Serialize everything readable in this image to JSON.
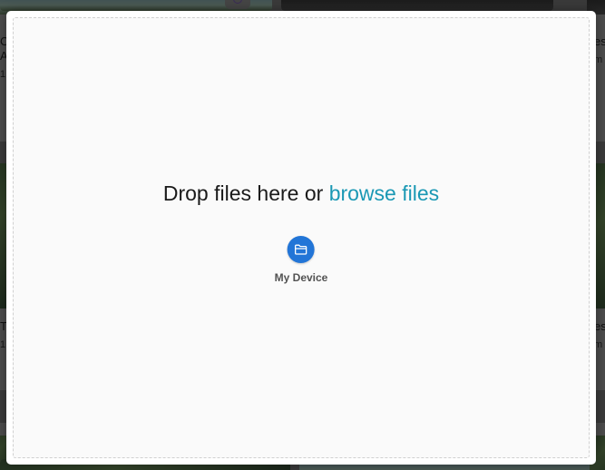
{
  "background": {
    "cards": [
      {
        "title_fragment": "C",
        "sub_fragment": "A",
        "meta_fragment": "1"
      },
      {
        "title_fragment": "es",
        "sub_fragment": "m"
      },
      {
        "title_fragment": "T",
        "meta_fragment": "1"
      },
      {
        "title_fragment": "es",
        "sub_fragment": "m"
      }
    ]
  },
  "uploader": {
    "drop_text": "Drop files here or",
    "browse_label": "browse files",
    "sources": [
      {
        "label": "My Device",
        "icon": "folder-icon"
      }
    ]
  },
  "colors": {
    "browse_link": "#1a98b4",
    "device_icon_bg": "#2275d7"
  }
}
